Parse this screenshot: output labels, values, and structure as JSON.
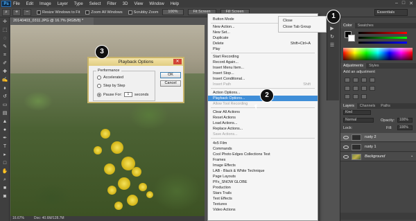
{
  "menubar": {
    "logo": "Ps",
    "items": [
      "File",
      "Edit",
      "Image",
      "Layer",
      "Type",
      "Select",
      "Filter",
      "3D",
      "View",
      "Window",
      "Help"
    ],
    "window_controls": [
      "–",
      "□",
      "✕"
    ]
  },
  "options_bar": {
    "checkboxes": [
      "Resize Windows to Fit",
      "Zoom All Windows",
      "Scrubby Zoom"
    ],
    "buttons": [
      "100%",
      "Fit Screen",
      "Fill Screen"
    ],
    "workspace": "Essentials"
  },
  "document": {
    "tab_title": "20140403_0311.JPG @ 16.7% (RGB/8) *",
    "zoom": "16.67%",
    "doc_info": "Doc: 40.6M/128.7M"
  },
  "dialog": {
    "title": "Playback Options",
    "close_glyph": "✕",
    "group_label": "Performance",
    "option_accelerated": "Accelerated",
    "option_step": "Step by Step",
    "option_pause": "Pause For:",
    "pause_value": "1",
    "pause_unit": "seconds",
    "ok_label": "OK",
    "cancel_label": "Cancel"
  },
  "callouts": {
    "c1": "1",
    "c2": "2",
    "c3": "3"
  },
  "context_menu": {
    "items": [
      {
        "label": "Button Mode",
        "shortcut": "",
        "disabled": false
      },
      {
        "label": "New Action...",
        "shortcut": "",
        "disabled": false
      },
      {
        "label": "New Set...",
        "shortcut": "",
        "disabled": false
      },
      {
        "label": "Duplicate",
        "shortcut": "",
        "disabled": false
      },
      {
        "label": "Delete",
        "shortcut": "Shift+Ctrl+A",
        "disabled": false
      },
      {
        "label": "Play",
        "shortcut": "",
        "disabled": false
      },
      {
        "label": "Start Recording",
        "shortcut": "",
        "disabled": false
      },
      {
        "label": "Record Again...",
        "shortcut": "",
        "disabled": false
      },
      {
        "label": "Insert Menu Item...",
        "shortcut": "",
        "disabled": false
      },
      {
        "label": "Insert Stop...",
        "shortcut": "",
        "disabled": false
      },
      {
        "label": "Insert Conditional...",
        "shortcut": "",
        "disabled": false
      },
      {
        "label": "Insert Path",
        "shortcut": "Shift",
        "disabled": true
      },
      {
        "label": "Action Options...",
        "shortcut": "",
        "disabled": false
      },
      {
        "label": "Playback Options...",
        "shortcut": "",
        "disabled": false,
        "highlighted": true
      },
      {
        "label": "Allow Tool Recording",
        "shortcut": "",
        "disabled": true
      },
      {
        "label": "Clear All Actions",
        "shortcut": "",
        "disabled": false
      },
      {
        "label": "Reset Actions",
        "shortcut": "",
        "disabled": false
      },
      {
        "label": "Load Actions...",
        "shortcut": "",
        "disabled": false
      },
      {
        "label": "Replace Actions...",
        "shortcut": "",
        "disabled": false
      },
      {
        "label": "Save Actions...",
        "shortcut": "",
        "disabled": true
      },
      {
        "label": "4x5 Film",
        "shortcut": "",
        "disabled": false
      },
      {
        "label": "Commands",
        "shortcut": "",
        "disabled": false
      },
      {
        "label": "Cool Photo Edges Collections Test",
        "shortcut": "",
        "disabled": false
      },
      {
        "label": "Frames",
        "shortcut": "",
        "disabled": false
      },
      {
        "label": "Image Effects",
        "shortcut": "",
        "disabled": false
      },
      {
        "label": "LAB - Black & White Technique",
        "shortcut": "",
        "disabled": false
      },
      {
        "label": "Page Layouts",
        "shortcut": "",
        "disabled": false
      },
      {
        "label": "PFx_SNOW GLOBE",
        "shortcut": "",
        "disabled": false
      },
      {
        "label": "Production",
        "shortcut": "",
        "disabled": false
      },
      {
        "label": "Stars Trails",
        "shortcut": "",
        "disabled": false
      },
      {
        "label": "Text Effects",
        "shortcut": "",
        "disabled": false
      },
      {
        "label": "Textures",
        "shortcut": "",
        "disabled": false
      },
      {
        "label": "Video Actions",
        "shortcut": "",
        "disabled": false
      }
    ]
  },
  "submenu": {
    "items": [
      "Close",
      "Close Tab Group"
    ]
  },
  "color_panel": {
    "tabs": [
      "Color",
      "Swatches"
    ]
  },
  "adjustments_panel": {
    "tabs": [
      "Adjustments",
      "Styles"
    ],
    "heading": "Add an adjustment"
  },
  "layers_panel": {
    "tabs": [
      "Layers",
      "Channels",
      "Paths"
    ],
    "kind_filter": "Kind",
    "blend_mode": "Normal",
    "opacity_label": "Opacity:",
    "opacity_value": "100%",
    "lock_label": "Lock:",
    "fill_label": "Fill:",
    "fill_value": "100%",
    "layers": [
      {
        "name": "rusty 2",
        "italic": false
      },
      {
        "name": "rusty 1",
        "italic": false
      },
      {
        "name": "Background",
        "italic": true
      }
    ],
    "lock_glyph": "▪"
  }
}
